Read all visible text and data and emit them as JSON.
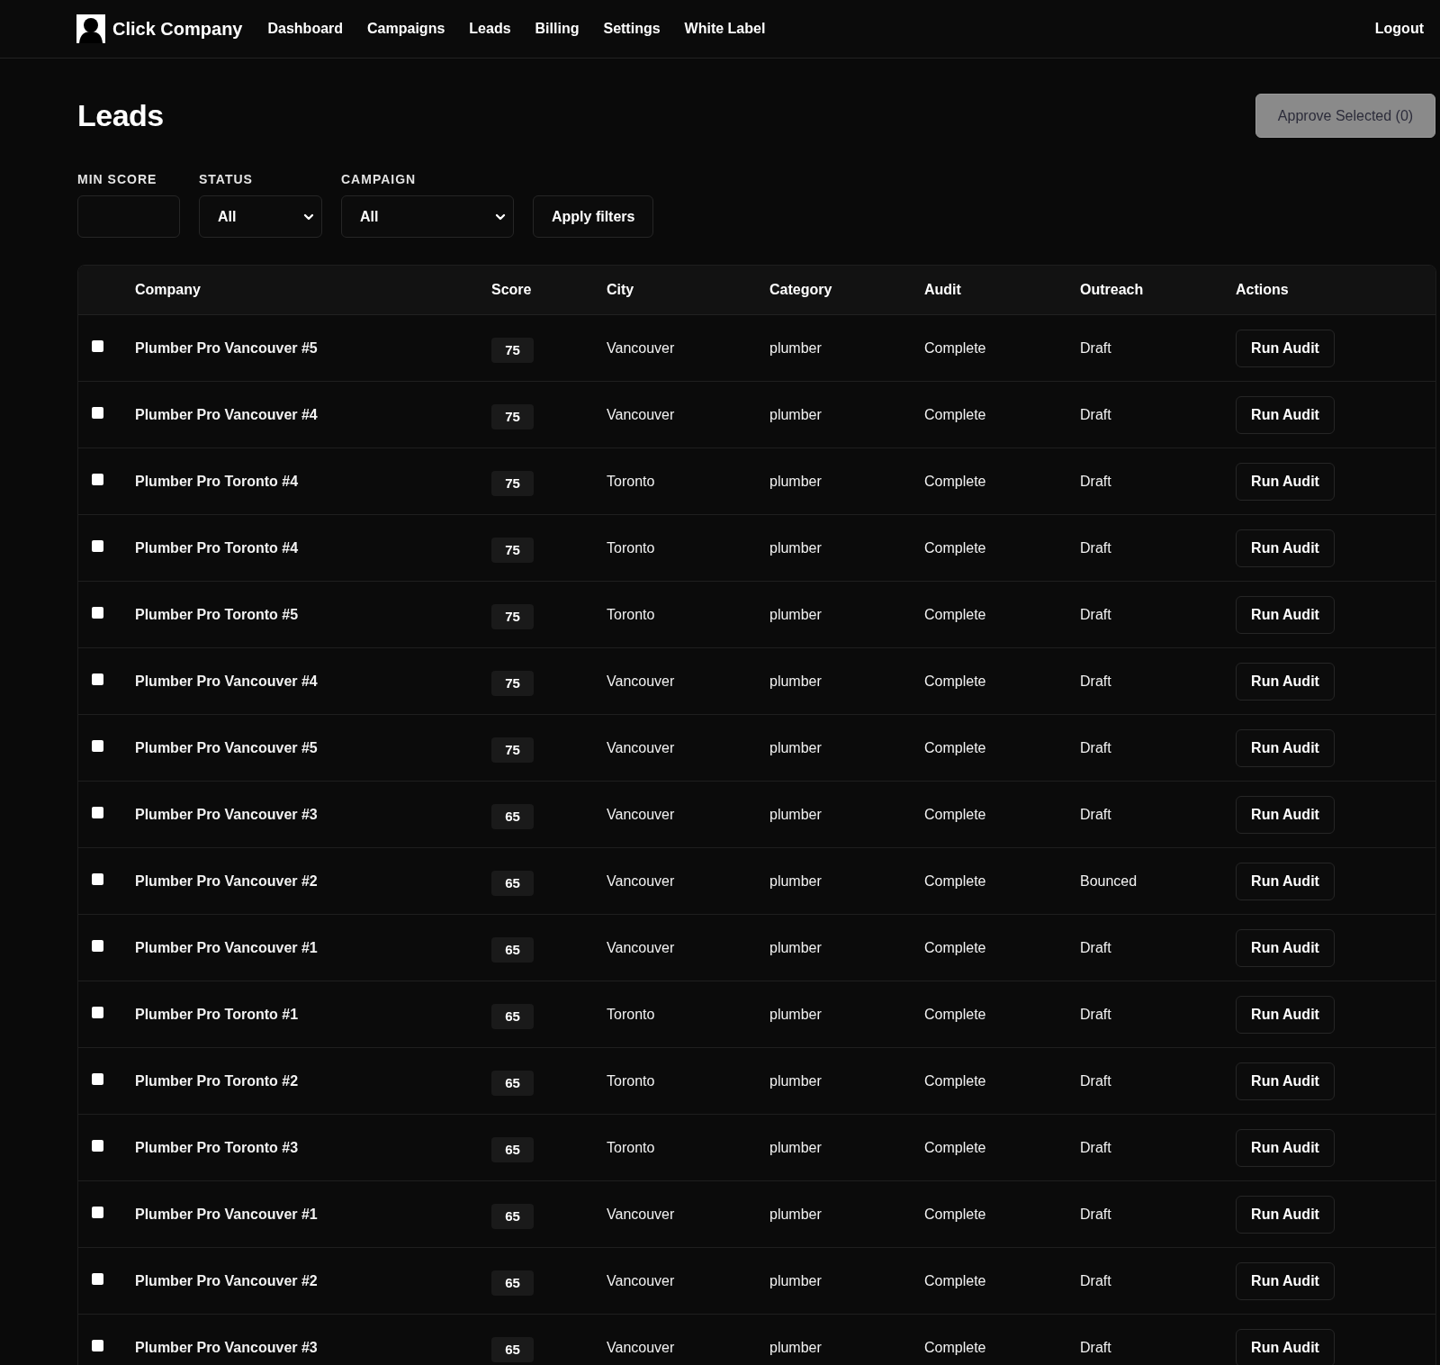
{
  "nav": {
    "brand": "Click Company",
    "links": [
      "Dashboard",
      "Campaigns",
      "Leads",
      "Billing",
      "Settings",
      "White Label"
    ],
    "logout": "Logout"
  },
  "page": {
    "title": "Leads",
    "approve_button": {
      "label": "Approve Selected (0)",
      "disabled": true
    }
  },
  "filters": {
    "fields": [
      {
        "kind": "input",
        "label": "MIN SCORE"
      },
      {
        "kind": "select",
        "label": "STATUS",
        "value": "All"
      },
      {
        "kind": "select",
        "label": "CAMPAIGN",
        "value": "All"
      }
    ],
    "apply_button": "Apply filters"
  },
  "table": {
    "columns": [
      "Company",
      "Score",
      "City",
      "Category",
      "Audit",
      "Outreach",
      "Actions"
    ],
    "rows": [
      {
        "checked": false,
        "company": "Plumber Pro Vancouver #5",
        "score": "75",
        "city": "Vancouver",
        "category": "plumber",
        "audit": "Complete",
        "outreach": "Draft",
        "action": "Run Audit"
      },
      {
        "checked": false,
        "company": "Plumber Pro Vancouver #4",
        "score": "75",
        "city": "Vancouver",
        "category": "plumber",
        "audit": "Complete",
        "outreach": "Draft",
        "action": "Run Audit"
      },
      {
        "checked": false,
        "company": "Plumber Pro Toronto #4",
        "score": "75",
        "city": "Toronto",
        "category": "plumber",
        "audit": "Complete",
        "outreach": "Draft",
        "action": "Run Audit"
      },
      {
        "checked": false,
        "company": "Plumber Pro Toronto #4",
        "score": "75",
        "city": "Toronto",
        "category": "plumber",
        "audit": "Complete",
        "outreach": "Draft",
        "action": "Run Audit"
      },
      {
        "checked": false,
        "company": "Plumber Pro Toronto #5",
        "score": "75",
        "city": "Toronto",
        "category": "plumber",
        "audit": "Complete",
        "outreach": "Draft",
        "action": "Run Audit"
      },
      {
        "checked": false,
        "company": "Plumber Pro Vancouver #4",
        "score": "75",
        "city": "Vancouver",
        "category": "plumber",
        "audit": "Complete",
        "outreach": "Draft",
        "action": "Run Audit"
      },
      {
        "checked": false,
        "company": "Plumber Pro Vancouver #5",
        "score": "75",
        "city": "Vancouver",
        "category": "plumber",
        "audit": "Complete",
        "outreach": "Draft",
        "action": "Run Audit"
      },
      {
        "checked": false,
        "company": "Plumber Pro Vancouver #3",
        "score": "65",
        "city": "Vancouver",
        "category": "plumber",
        "audit": "Complete",
        "outreach": "Draft",
        "action": "Run Audit"
      },
      {
        "checked": false,
        "company": "Plumber Pro Vancouver #2",
        "score": "65",
        "city": "Vancouver",
        "category": "plumber",
        "audit": "Complete",
        "outreach": "Bounced",
        "action": "Run Audit"
      },
      {
        "checked": false,
        "company": "Plumber Pro Vancouver #1",
        "score": "65",
        "city": "Vancouver",
        "category": "plumber",
        "audit": "Complete",
        "outreach": "Draft",
        "action": "Run Audit"
      },
      {
        "checked": false,
        "company": "Plumber Pro Toronto #1",
        "score": "65",
        "city": "Toronto",
        "category": "plumber",
        "audit": "Complete",
        "outreach": "Draft",
        "action": "Run Audit"
      },
      {
        "checked": false,
        "company": "Plumber Pro Toronto #2",
        "score": "65",
        "city": "Toronto",
        "category": "plumber",
        "audit": "Complete",
        "outreach": "Draft",
        "action": "Run Audit"
      },
      {
        "checked": false,
        "company": "Plumber Pro Toronto #3",
        "score": "65",
        "city": "Toronto",
        "category": "plumber",
        "audit": "Complete",
        "outreach": "Draft",
        "action": "Run Audit"
      },
      {
        "checked": false,
        "company": "Plumber Pro Vancouver #1",
        "score": "65",
        "city": "Vancouver",
        "category": "plumber",
        "audit": "Complete",
        "outreach": "Draft",
        "action": "Run Audit"
      },
      {
        "checked": false,
        "company": "Plumber Pro Vancouver #2",
        "score": "65",
        "city": "Vancouver",
        "category": "plumber",
        "audit": "Complete",
        "outreach": "Draft",
        "action": "Run Audit"
      },
      {
        "checked": false,
        "company": "Plumber Pro Vancouver #3",
        "score": "65",
        "city": "Vancouver",
        "category": "plumber",
        "audit": "Complete",
        "outreach": "Draft",
        "action": "Run Audit"
      }
    ]
  }
}
